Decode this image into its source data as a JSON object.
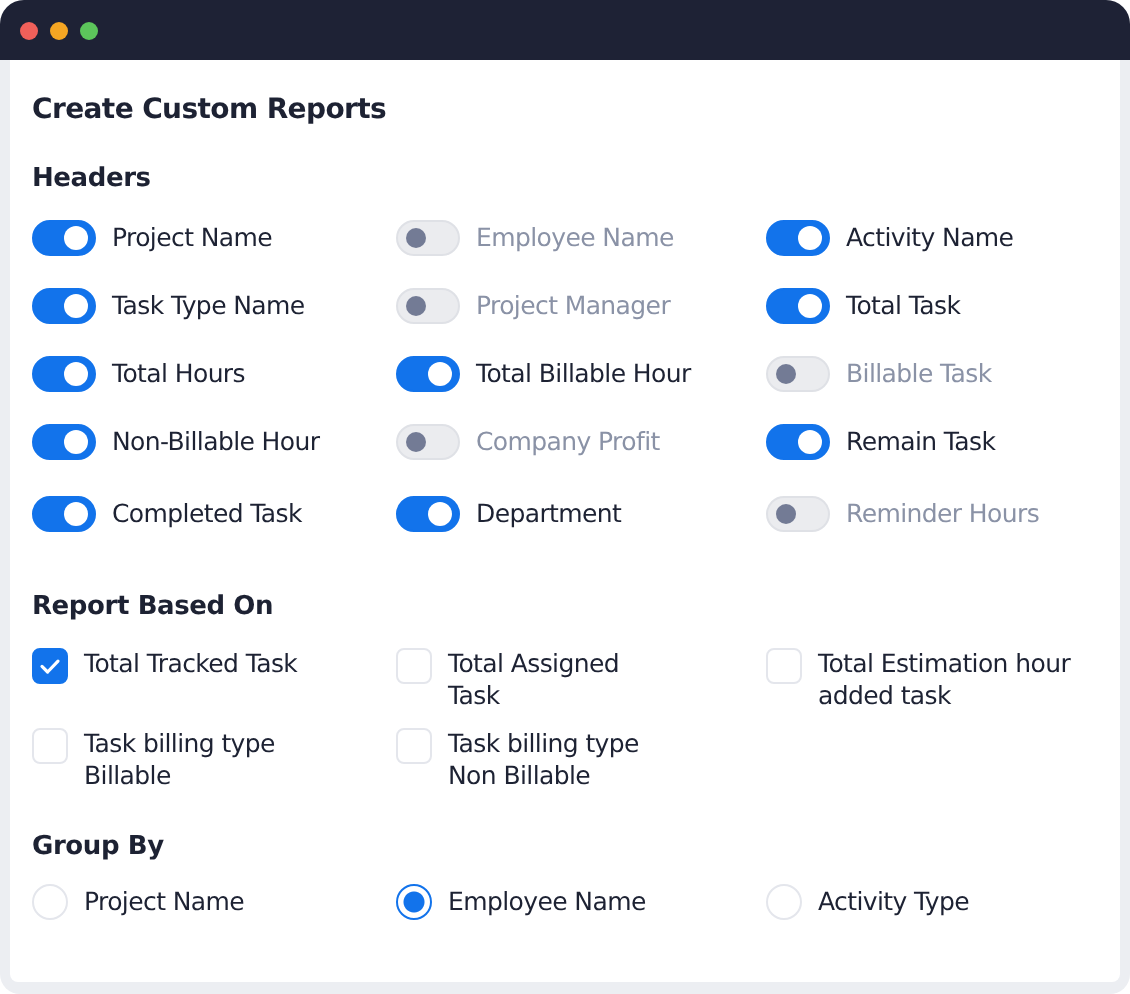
{
  "window": {
    "title": "Create Custom Reports"
  },
  "headers": {
    "title": "Headers",
    "items": [
      {
        "label": "Project Name",
        "on": true
      },
      {
        "label": "Employee Name",
        "on": false
      },
      {
        "label": "Activity Name",
        "on": true
      },
      {
        "label": "Task Type Name",
        "on": true
      },
      {
        "label": "Project Manager",
        "on": false
      },
      {
        "label": "Total Task",
        "on": true
      },
      {
        "label": "Total Hours",
        "on": true
      },
      {
        "label": "Total Billable Hour",
        "on": true
      },
      {
        "label": "Billable Task",
        "on": false
      },
      {
        "label": "Non-Billable Hour",
        "on": true
      },
      {
        "label": "Company Profit",
        "on": false
      },
      {
        "label": "Remain Task",
        "on": true
      },
      {
        "label": "Completed Task",
        "on": true
      },
      {
        "label": "Department",
        "on": true
      },
      {
        "label": "Reminder Hours",
        "on": false
      }
    ]
  },
  "report_based_on": {
    "title": "Report Based On",
    "items": [
      {
        "label": "Total Tracked Task",
        "checked": true
      },
      {
        "label": "Total Assigned Task",
        "checked": false
      },
      {
        "label": "Total Estimation hour added task",
        "checked": false
      },
      {
        "label": "Task billing type Billable",
        "checked": false
      },
      {
        "label": "Task billing type Non Billable",
        "checked": false
      }
    ]
  },
  "group_by": {
    "title": "Group By",
    "items": [
      {
        "label": "Project Name",
        "selected": false
      },
      {
        "label": "Employee Name",
        "selected": true
      },
      {
        "label": "Activity Type",
        "selected": false
      }
    ]
  }
}
